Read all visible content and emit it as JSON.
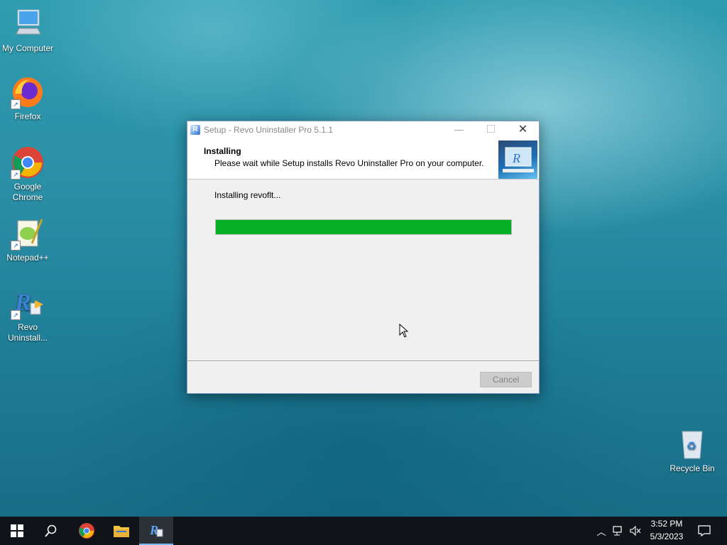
{
  "desktop": {
    "icons": [
      {
        "label": "My Computer"
      },
      {
        "label": "Firefox"
      },
      {
        "label": "Google Chrome"
      },
      {
        "label": "Notepad++"
      },
      {
        "label": "Revo Uninstall..."
      },
      {
        "label": "Recycle Bin"
      }
    ]
  },
  "dialog": {
    "title": "Setup - Revo Uninstaller Pro 5.1.1",
    "header_title": "Installing",
    "header_subtitle": "Please wait while Setup installs Revo Uninstaller Pro on your computer.",
    "status_text": "Installing revoflt...",
    "progress": 1.0,
    "cancel_label": "Cancel",
    "accent_color": "#06b025"
  },
  "taskbar": {
    "time": "3:52 PM",
    "date": "5/3/2023"
  }
}
